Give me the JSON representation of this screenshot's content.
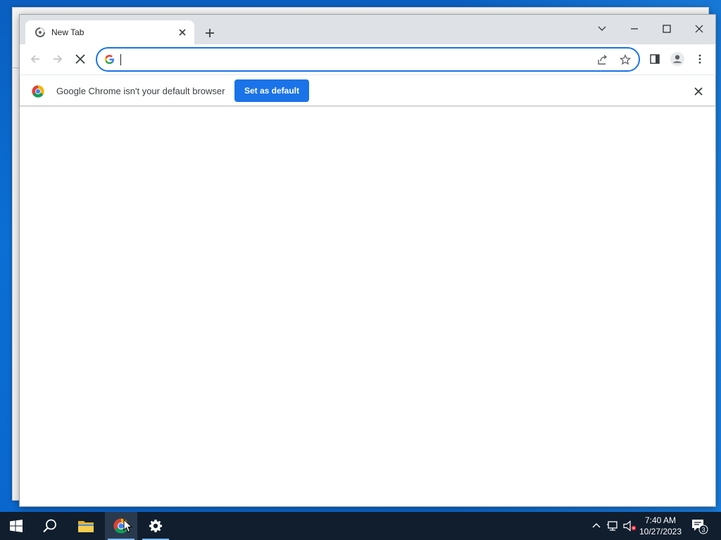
{
  "browser": {
    "tab": {
      "title": "New Tab"
    },
    "omnibox": {
      "value": "",
      "placeholder": ""
    },
    "infobar": {
      "message": "Google Chrome isn't your default browser",
      "button_label": "Set as default"
    }
  },
  "taskbar": {
    "apps": [
      {
        "name": "start",
        "icon": "windows-logo-icon"
      },
      {
        "name": "search",
        "icon": "search-icon"
      },
      {
        "name": "file-explorer",
        "icon": "folder-icon"
      },
      {
        "name": "chrome",
        "icon": "chrome-icon",
        "active": true
      },
      {
        "name": "settings",
        "icon": "gear-icon"
      }
    ],
    "clock": {
      "time": "7:40 AM",
      "date": "10/27/2023"
    },
    "notifications": {
      "count": "3"
    }
  },
  "colors": {
    "accent": "#1a73e8",
    "titlebar": "#dee1e6",
    "taskbar": "#101e2e",
    "desktop": "#0b6fd4"
  }
}
